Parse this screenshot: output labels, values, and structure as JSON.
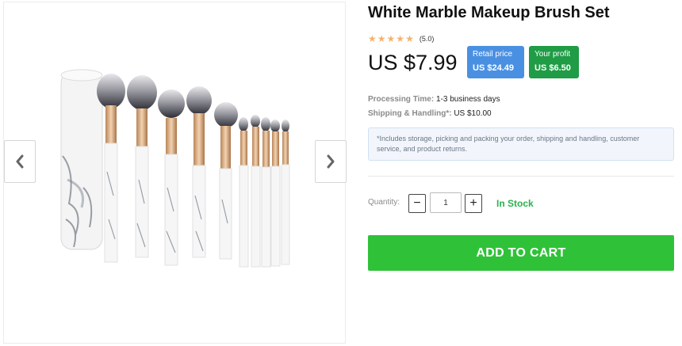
{
  "product": {
    "title": "White Marble Makeup Brush Set",
    "rating": {
      "stars": 5,
      "value_text": "(5.0)"
    },
    "price": "US $7.99",
    "retail_badge": {
      "label": "Retail price",
      "value": "US $24.49"
    },
    "profit_badge": {
      "label": "Your profit",
      "value": "US $6.50"
    }
  },
  "shipping": {
    "processing_label": "Processing Time:",
    "processing_value": "1-3 business days",
    "shipping_label": "Shipping & Handling*:",
    "shipping_value": "US $10.00",
    "note": "*Includes storage, picking and packing your order, shipping and handling, customer service, and product returns."
  },
  "quantity": {
    "label": "Quantity:",
    "minus": "−",
    "plus": "+",
    "value": "1",
    "stock_status": "In Stock"
  },
  "cart_button": "ADD TO CART",
  "colors": {
    "retail_badge": "#4a90e2",
    "profit_badge": "#1f9c45",
    "stock": "#2ab24b",
    "cart_button": "#2fc239",
    "star": "#f6b26b"
  },
  "icons": {
    "prev": "chevron-left-icon",
    "next": "chevron-right-icon",
    "star": "star-icon"
  }
}
